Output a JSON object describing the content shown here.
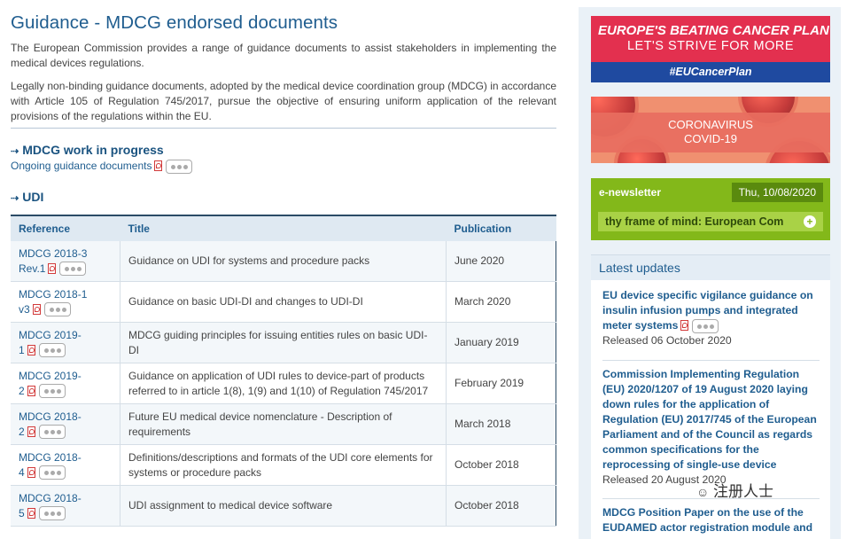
{
  "page": {
    "title": "Guidance - MDCG endorsed documents",
    "intro1": "The European Commission provides a range of guidance documents to assist stakeholders in implementing the medical devices regulations.",
    "intro2": "Legally non-binding guidance documents, adopted by the medical device coordination group (MDCG) in accordance with Article 105 of Regulation 745/2017, pursue the objective of ensuring uniform application of the relevant provisions of the regulations within the EU."
  },
  "wip": {
    "heading": "MDCG work in progress",
    "link": "Ongoing guidance documents"
  },
  "udi": {
    "heading": "UDI",
    "columns": [
      "Reference",
      "Title",
      "Publication"
    ],
    "rows": [
      {
        "ref1": "MDCG 2018-3",
        "ref2": "Rev.1",
        "title": "Guidance on UDI for systems and procedure packs",
        "pub": "June 2020"
      },
      {
        "ref1": "MDCG 2018-1",
        "ref2": "v3",
        "title": "Guidance on basic UDI-DI and changes to UDI-DI",
        "pub": "March 2020"
      },
      {
        "ref1": "MDCG 2019-",
        "ref2": "1",
        "title": "MDCG guiding principles for issuing entities rules on basic UDI-DI",
        "pub": "January 2019"
      },
      {
        "ref1": "MDCG 2019-",
        "ref2": "2",
        "title": "Guidance on application of UDI rules to device-part of products referred to in article 1(8), 1(9) and 1(10) of Regulation 745/2017",
        "pub": "February 2019"
      },
      {
        "ref1": "MDCG 2018-",
        "ref2": "2",
        "title": "Future EU medical device nomenclature - Description of requirements",
        "pub": "March 2018"
      },
      {
        "ref1": "MDCG 2018-",
        "ref2": "4",
        "title": "Definitions/descriptions and formats of the UDI core elements for systems or procedure packs",
        "pub": "October 2018"
      },
      {
        "ref1": "MDCG 2018-",
        "ref2": "5",
        "title": "UDI assignment to medical device software",
        "pub": "October 2018"
      }
    ]
  },
  "sidebar": {
    "banner1": {
      "line1": "EUROPE'S BEATING CANCER PLAN",
      "line2": "LET'S STRIVE FOR MORE",
      "tag": "#EUCancerPlan"
    },
    "banner2": {
      "line1": "CORONAVIRUS",
      "line2": "COVID-19"
    },
    "newsletter": {
      "label": "e-newsletter",
      "date": "Thu, 10/08/2020",
      "ticker": "thy frame of mind: European Com"
    },
    "updates": {
      "heading": "Latest updates",
      "items": [
        {
          "title": "EU device specific vigilance guidance on insulin infusion pumps and integrated meter systems",
          "released": "Released 06 October 2020"
        },
        {
          "title": "Commission Implementing Regulation (EU) 2020/1207 of 19 August 2020 laying down rules for the application of Regulation (EU) 2017/745 of the European Parliament and of the Council as regards common specifications for the reprocessing of single-use device",
          "released": "Released 20 August 2020"
        },
        {
          "title": "MDCG Position Paper on the use of the EUDAMED actor registration module and"
        }
      ]
    }
  },
  "watermark": "注册人士",
  "colors": {
    "link": "#1f5d8f",
    "cancer_red": "#e3304f",
    "cancer_blue": "#1f4aa0",
    "newsletter_green": "#83b81a"
  }
}
